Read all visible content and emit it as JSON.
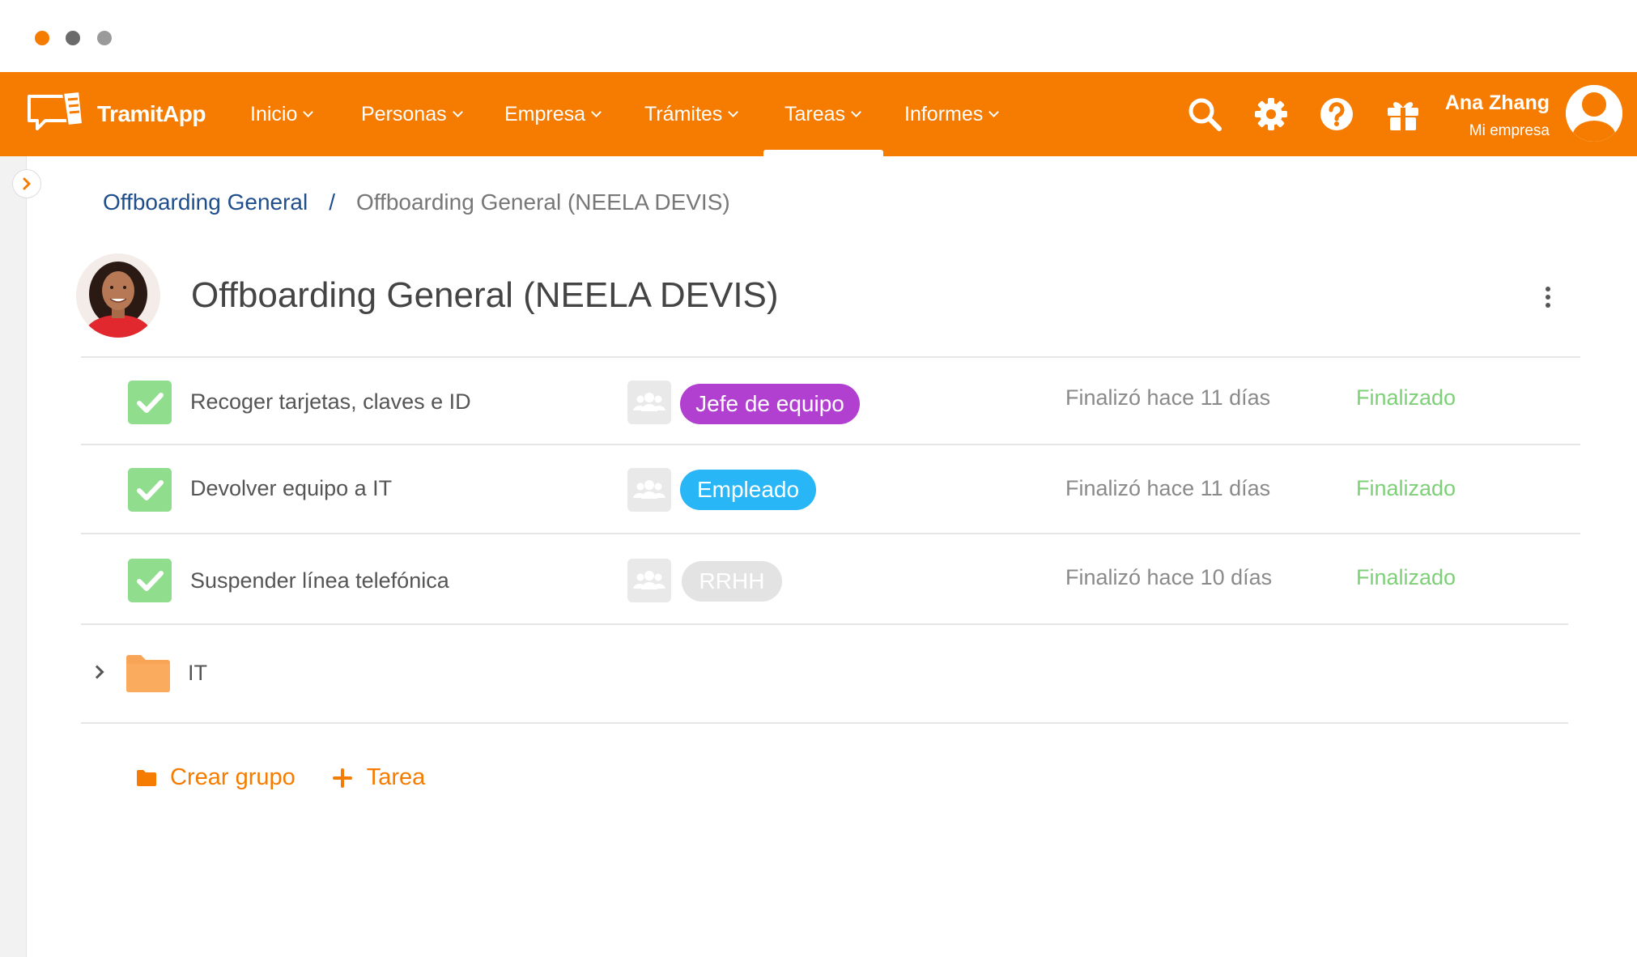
{
  "app": {
    "name": "TramitApp"
  },
  "nav": {
    "items": [
      {
        "label": "Inicio"
      },
      {
        "label": "Personas"
      },
      {
        "label": "Empresa"
      },
      {
        "label": "Trámites"
      },
      {
        "label": "Tareas",
        "active": true
      },
      {
        "label": "Informes"
      }
    ],
    "icons": [
      "search-icon",
      "gear-icon",
      "help-icon",
      "gift-icon"
    ]
  },
  "user": {
    "name": "Ana Zhang",
    "company": "Mi empresa"
  },
  "breadcrumb": {
    "parent": "Offboarding General",
    "separator": "/",
    "current": "Offboarding General (NEELA DEVIS)"
  },
  "page": {
    "title": "Offboarding General (NEELA DEVIS)"
  },
  "tasks": [
    {
      "name": "Recoger tarjetas, claves e ID",
      "assignee": "Jefe de equipo",
      "assignee_color": "#b13fd0",
      "finished": "Finalizó hace 11 días",
      "status": "Finalizado"
    },
    {
      "name": "Devolver equipo a IT",
      "assignee": "Empleado",
      "assignee_color": "#29b6f6",
      "finished": "Finalizó hace 11 días",
      "status": "Finalizado"
    },
    {
      "name": "Suspender línea telefónica",
      "assignee": "RRHH",
      "assignee_color": "#e3e3e3",
      "finished": "Finalizó hace 10 días",
      "status": "Finalizado"
    }
  ],
  "folder": {
    "label": "IT"
  },
  "actions": {
    "create_group": "Crear grupo",
    "add_task": "Tarea"
  },
  "colors": {
    "brand": "#f57c00",
    "status_done": "#7dd077",
    "check": "#90dd8e",
    "link": "#1f4e8c"
  }
}
